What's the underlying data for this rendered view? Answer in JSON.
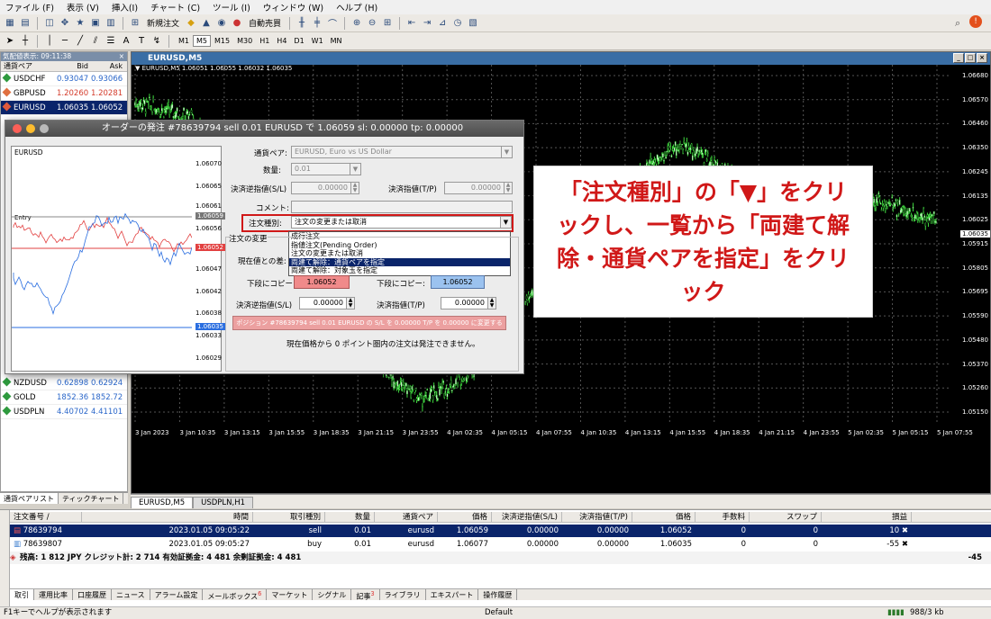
{
  "menu": [
    "ファイル (F)",
    "表示 (V)",
    "挿入(I)",
    "チャート (C)",
    "ツール (I)",
    "ウィンドウ (W)",
    "ヘルプ (H)"
  ],
  "toolbar": {
    "new_order": "新規注文",
    "auto_trade": "自動売買"
  },
  "timeframes": [
    "M1",
    "M5",
    "M15",
    "M30",
    "H1",
    "H4",
    "D1",
    "W1",
    "MN"
  ],
  "market_watch": {
    "title": "気配値表示: 09:11:38",
    "head": {
      "symbol": "通貨ペア",
      "bid": "Bid",
      "ask": "Ask"
    },
    "rows_top": [
      {
        "symbol": "USDCHF",
        "bid": "0.93047",
        "ask": "0.93066",
        "dir": "up"
      },
      {
        "symbol": "GBPUSD",
        "bid": "1.20260",
        "ask": "1.20281",
        "dir": "dn"
      },
      {
        "symbol": "EURUSD",
        "bid": "1.06035",
        "ask": "1.06052",
        "dir": "dn",
        "selected": true
      }
    ],
    "rows_bottom": [
      {
        "symbol": "NZDUSD",
        "bid": "0.62898",
        "ask": "0.62924",
        "dir": "up"
      },
      {
        "symbol": "GOLD",
        "bid": "1852.36",
        "ask": "1852.72",
        "dir": "up"
      },
      {
        "symbol": "USDPLN",
        "bid": "4.40702",
        "ask": "4.41101",
        "dir": "up"
      }
    ],
    "tabs": [
      "通貨ペアリスト",
      "ティックチャート"
    ]
  },
  "chart": {
    "window_title": "EURUSD,M5",
    "ohlc": "▼ EURUSD,M5  1.06051 1.06055 1.06032 1.06035",
    "price_tag": "1.06035",
    "tabs": [
      "EURUSD,M5",
      "USDPLN,H1"
    ]
  },
  "chart_data": {
    "type": "candlestick",
    "title": "EURUSD,M5",
    "x_ticks": [
      "3 Jan 2023",
      "3 Jan 10:35",
      "3 Jan 13:15",
      "3 Jan 15:55",
      "3 Jan 18:35",
      "3 Jan 21:15",
      "3 Jan 23:55",
      "4 Jan 02:35",
      "4 Jan 05:15",
      "4 Jan 07:55",
      "4 Jan 10:35",
      "4 Jan 13:15",
      "4 Jan 15:55",
      "4 Jan 18:35",
      "4 Jan 21:15",
      "4 Jan 23:55",
      "5 Jan 02:35",
      "5 Jan 05:15",
      "5 Jan 07:55"
    ],
    "y_ticks": [
      "1.06680",
      "1.06570",
      "1.06460",
      "1.06350",
      "1.06245",
      "1.06135",
      "1.06025",
      "1.05915",
      "1.05805",
      "1.05695",
      "1.05590",
      "1.05480",
      "1.05370",
      "1.05260",
      "1.05150"
    ],
    "ylim": [
      1.0515,
      1.0668
    ],
    "series": [
      {
        "values": [
          1.0655,
          1.0652,
          1.0648,
          1.0632,
          1.0615,
          1.0598,
          1.0582,
          1.0566,
          1.0548,
          1.0532,
          1.0522,
          1.0528,
          1.0538,
          1.0555,
          1.0572,
          1.0588,
          1.0602,
          1.0616,
          1.0628,
          1.0636,
          1.063,
          1.0621,
          1.0612,
          1.0606,
          1.061,
          1.0615,
          1.0611,
          1.0606,
          1.0603
        ]
      }
    ]
  },
  "dialog": {
    "title": "オーダーの発注 #78639794 sell 0.01 EURUSD で 1.06059 sl: 0.00000 tp: 0.00000",
    "mini_chart": {
      "symbol": "EURUSD",
      "entry": "Entry",
      "prices": [
        "1.06070",
        "1.06065",
        "1.06061",
        "1.06059",
        "1.06056",
        "1.06052",
        "1.06047",
        "1.06042",
        "1.06038",
        "1.06035",
        "1.06033",
        "1.06029"
      ]
    },
    "symbol_label": "通貨ペア:",
    "symbol_value": "EURUSD, Euro vs US Dollar",
    "volume_label": "数量:",
    "volume_value": "0.01",
    "sl_label": "決済逆指値(S/L)",
    "sl_value": "0.00000",
    "tp_label": "決済指値(T/P)",
    "tp_value": "0.00000",
    "comment_label": "コメント:",
    "type_label": "注文種別:",
    "type_value": "注文の変更または取消",
    "dropdown_options": [
      "成行注文",
      "指値注文(Pending Order)",
      "注文の変更または取消",
      "両建て解除：通貨ペアを指定",
      "両建て解除：対象玉を指定"
    ],
    "selected_option": 3,
    "section_label": "注文の変更",
    "current_label": "現在値との差:",
    "copy_sl_label": "下段にコピー:",
    "copy_sl_value": "1.06052",
    "copy_tp_label": "下段にコピー:",
    "copy_tp_value": "1.06052",
    "sl2_label": "決済逆指値(S/L)",
    "sl2_value": "0.00000",
    "tp2_label": "決済指値(T/P)",
    "tp2_value": "0.00000",
    "modify_button": "ポジション #78639794 sell 0.01 EURUSD の S/L を 0.00000 T/P を 0.00000 に変更する",
    "note": "現在価格から 0 ポイント圏内の注文は発注できません。"
  },
  "callout": "「注文種別」の「▼」をクリックし、一覧から「両建て解除・通貨ペアを指定」をクリック",
  "terminal": {
    "headers": [
      "注文番号 /",
      "時間",
      "取引種別",
      "数量",
      "通貨ペア",
      "価格",
      "決済逆指値(S/L)",
      "決済指値(T/P)",
      "価格",
      "手数料",
      "スワップ",
      "損益"
    ],
    "rows": [
      [
        "78639794",
        "2023.01.05 09:05:22",
        "sell",
        "0.01",
        "eurusd",
        "1.06059",
        "0.00000",
        "0.00000",
        "1.06052",
        "0",
        "0",
        "10"
      ],
      [
        "78639807",
        "2023.01.05 09:05:27",
        "buy",
        "0.01",
        "eurusd",
        "1.06077",
        "0.00000",
        "0.00000",
        "1.06035",
        "0",
        "0",
        "-55"
      ]
    ],
    "summary": "残高: 1 812 JPY  クレジット計: 2 714  有効証拠金: 4 481  余剰証拠金: 4 481",
    "summary_pl": "-45",
    "tabs": [
      "取引",
      "運用比率",
      "口座履歴",
      "ニュース",
      "アラーム設定",
      "メールボックス",
      "マーケット",
      "シグナル",
      "記事",
      "ライブラリ",
      "エキスパート",
      "操作履歴"
    ],
    "badge_mail": "6",
    "badge_article": "3"
  },
  "statusbar": {
    "help": "F1キーでヘルプが表示されます",
    "profile": "Default",
    "traffic": "988/3 kb"
  }
}
